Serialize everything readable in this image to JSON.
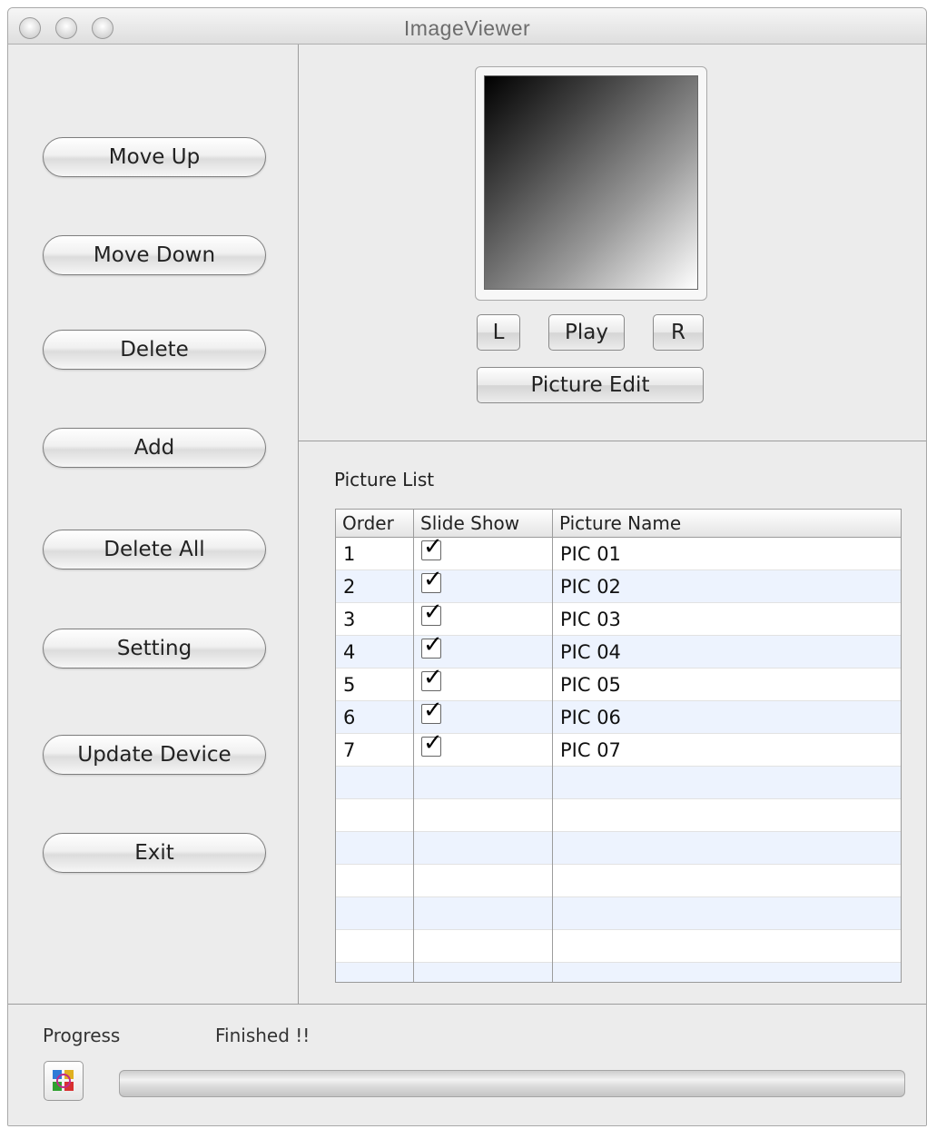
{
  "window": {
    "title": "ImageViewer"
  },
  "left_buttons": [
    {
      "label": "Move Up"
    },
    {
      "label": "Move Down"
    },
    {
      "label": "Delete"
    },
    {
      "label": "Add"
    },
    {
      "label": "Delete All"
    },
    {
      "label": "Setting"
    },
    {
      "label": "Update Device"
    },
    {
      "label": "Exit"
    }
  ],
  "preview": {
    "left_label": "L",
    "play_label": "Play",
    "right_label": "R",
    "edit_label": "Picture Edit"
  },
  "picture_list": {
    "title": "Picture List",
    "columns": [
      "Order",
      "Slide Show",
      "Picture Name"
    ],
    "rows": [
      {
        "order": "1",
        "slide_show": true,
        "name": "PIC 01"
      },
      {
        "order": "2",
        "slide_show": true,
        "name": "PIC 02"
      },
      {
        "order": "3",
        "slide_show": true,
        "name": "PIC 03"
      },
      {
        "order": "4",
        "slide_show": true,
        "name": "PIC 04"
      },
      {
        "order": "5",
        "slide_show": true,
        "name": "PIC 05"
      },
      {
        "order": "6",
        "slide_show": true,
        "name": "PIC 06"
      },
      {
        "order": "7",
        "slide_show": true,
        "name": "PIC 07"
      }
    ],
    "check_glyph": "✓"
  },
  "status": {
    "progress_label": "Progress",
    "status_text": "Finished !!",
    "progress_value": 1.0
  },
  "colors": {
    "row_alt": "#edf3fe",
    "window_bg": "#ececec"
  },
  "icons": [
    "app-icon"
  ]
}
